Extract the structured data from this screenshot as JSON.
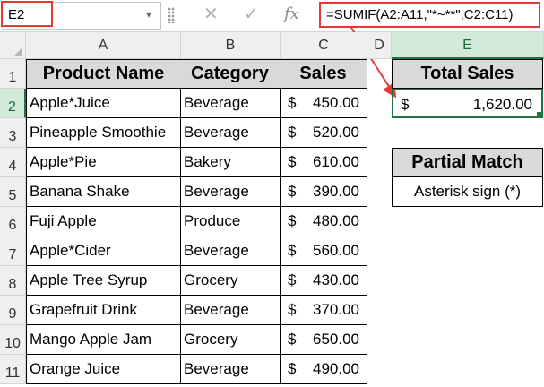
{
  "formula_bar": {
    "name_box": "E2",
    "formula": "=SUMIF(A2:A11,\"*~**\",C2:C11)",
    "cancel_icon": "✕",
    "enter_icon": "✓",
    "fx_label": "fx"
  },
  "columns": [
    "A",
    "B",
    "C",
    "D",
    "E"
  ],
  "rows": [
    "1",
    "2",
    "3",
    "4",
    "5",
    "6",
    "7",
    "8",
    "9",
    "10",
    "11"
  ],
  "table": {
    "headers": [
      "Product Name",
      "Category",
      "Sales"
    ],
    "rows": [
      {
        "product": "Apple*Juice",
        "category": "Beverage",
        "currency": "$",
        "sales": "450.00"
      },
      {
        "product": "Pineapple Smoothie",
        "category": "Beverage",
        "currency": "$",
        "sales": "520.00"
      },
      {
        "product": "Apple*Pie",
        "category": "Bakery",
        "currency": "$",
        "sales": "610.00"
      },
      {
        "product": "Banana Shake",
        "category": "Beverage",
        "currency": "$",
        "sales": "390.00"
      },
      {
        "product": "Fuji Apple",
        "category": "Produce",
        "currency": "$",
        "sales": "480.00"
      },
      {
        "product": "Apple*Cider",
        "category": "Beverage",
        "currency": "$",
        "sales": "560.00"
      },
      {
        "product": "Apple Tree Syrup",
        "category": "Grocery",
        "currency": "$",
        "sales": "430.00"
      },
      {
        "product": "Grapefruit Drink",
        "category": "Beverage",
        "currency": "$",
        "sales": "370.00"
      },
      {
        "product": "Mango Apple Jam",
        "category": "Grocery",
        "currency": "$",
        "sales": "650.00"
      },
      {
        "product": "Orange Juice",
        "category": "Beverage",
        "currency": "$",
        "sales": "490.00"
      }
    ]
  },
  "total_sales": {
    "header": "Total Sales",
    "currency": "$",
    "value": "1,620.00"
  },
  "partial_match": {
    "header": "Partial Match",
    "value": "Asterisk sign (*)"
  },
  "colors": {
    "selection_green": "#217346",
    "callout_red": "#e53935",
    "header_fill": "#d9d9d9"
  }
}
